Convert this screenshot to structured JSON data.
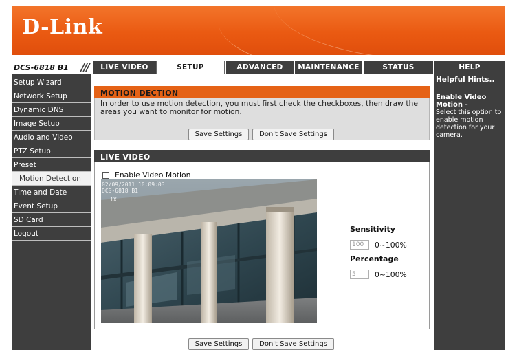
{
  "brand": {
    "logo": "D-Link"
  },
  "model": {
    "name": "DCS-6818 B1",
    "slashes": "///"
  },
  "nav": {
    "tabs": [
      {
        "label": "LIVE VIDEO"
      },
      {
        "label": "SETUP"
      },
      {
        "label": "ADVANCED"
      },
      {
        "label": "MAINTENANCE"
      },
      {
        "label": "STATUS"
      },
      {
        "label": "HELP"
      }
    ],
    "active": "SETUP"
  },
  "sidebar": {
    "items": [
      {
        "label": "Setup Wizard"
      },
      {
        "label": "Network Setup"
      },
      {
        "label": "Dynamic DNS"
      },
      {
        "label": "Image Setup"
      },
      {
        "label": "Audio and Video"
      },
      {
        "label": "PTZ Setup"
      },
      {
        "label": "Preset"
      },
      {
        "label": "Motion Detection"
      },
      {
        "label": "Time and Date"
      },
      {
        "label": "Event Setup"
      },
      {
        "label": "SD Card"
      },
      {
        "label": "Logout"
      }
    ],
    "active": "Motion Detection"
  },
  "motion": {
    "title": "MOTION DECTION",
    "description": "In order to use motion detection, you must first check the checkboxes, then draw the areas you want to monitor for motion.",
    "save_label": "Save Settings",
    "dont_save_label": "Don't Save Settings"
  },
  "live": {
    "title": "LIVE VIDEO",
    "enable_label": "Enable Video Motion",
    "enable_checked": false,
    "osd_line1": "02/09/2011 10:09:03",
    "osd_line2": "DCS-6818 B1",
    "osd_zoom": "1X",
    "sensitivity_label": "Sensitivity",
    "sensitivity_value": "100",
    "sensitivity_range": "0~100%",
    "percentage_label": "Percentage",
    "percentage_value": "5",
    "percentage_range": "0~100%"
  },
  "footer": {
    "save_label": "Save Settings",
    "dont_save_label": "Don't Save Settings"
  },
  "hints": {
    "title": "Helpful Hints..",
    "subtitle": "Enable Video Motion -",
    "body": "Select this option to enable motion detection for your camera."
  },
  "colors": {
    "accent": "#e56216",
    "dark": "#3e3e3e"
  }
}
